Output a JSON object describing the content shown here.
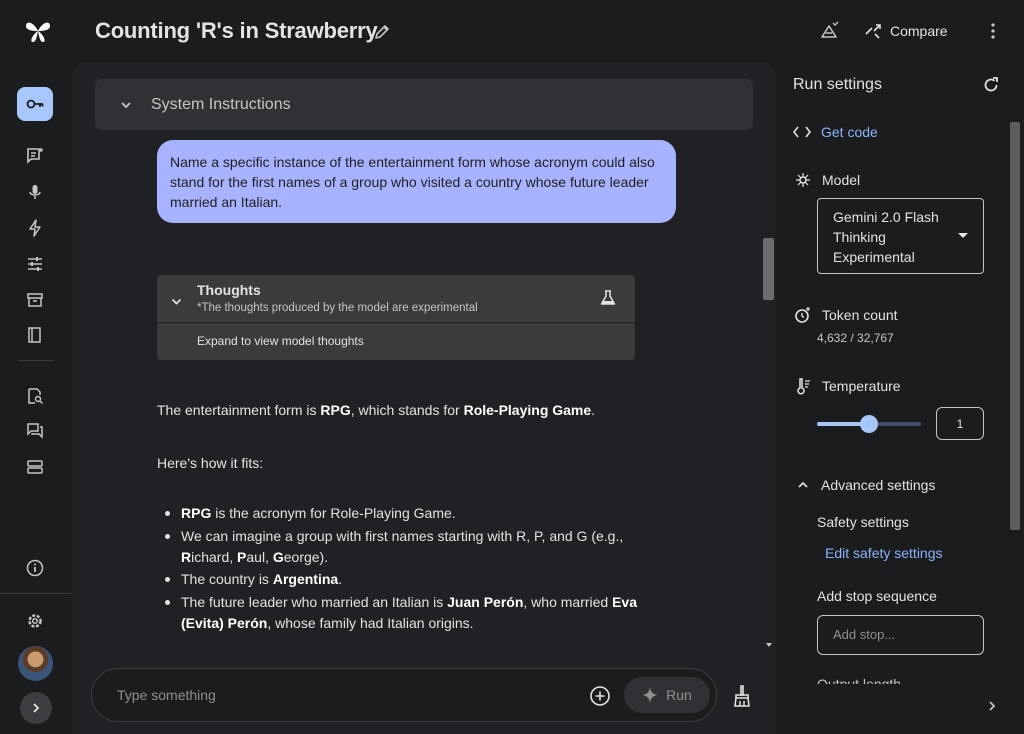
{
  "app": {
    "title": "Counting 'R's in Strawberry",
    "compare_label": "Compare"
  },
  "chat": {
    "system_instructions_label": "System Instructions",
    "user_message": "Name a specific instance of the entertainment form whose acronym could also stand for the first names of a group who visited a country whose future leader married an Italian.",
    "thoughts": {
      "title": "Thoughts",
      "subtitle": "*The thoughts produced by the model are experimental",
      "expand_label": "Expand to view model thoughts"
    },
    "response": {
      "p1": {
        "a": "The entertainment form is ",
        "b1": "RPG",
        "c": ", which stands for ",
        "b2": "Role-Playing Game",
        "d": "."
      },
      "p2": "Here's how it fits:",
      "bullets": {
        "b1": {
          "bold": "RPG",
          "text": " is the acronym for Role-Playing Game."
        },
        "b2": {
          "t1": "We can imagine a group with first names starting with R, P, and G (e.g., ",
          "r": "R",
          "r_rest": "ichard, ",
          "p": "P",
          "p_rest": "aul, ",
          "g": "G",
          "g_rest": "eorge)."
        },
        "b3": {
          "text": "The country is ",
          "bold": "Argentina",
          "end": "."
        },
        "b4": {
          "t1": "The future leader who married an Italian is ",
          "bold1": "Juan Perón",
          "t2": ", who married ",
          "bold2": "Eva (Evita) Perón",
          "t3": ", whose family had Italian origins."
        }
      }
    },
    "input_placeholder": "Type something",
    "run_label": "Run"
  },
  "settings": {
    "title": "Run settings",
    "get_code_label": "Get code",
    "model_label": "Model",
    "model_value": "Gemini 2.0 Flash Thinking Experimental",
    "token_count_label": "Token count",
    "token_count_value": "4,632 / 32,767",
    "temperature_label": "Temperature",
    "temperature_value": "1",
    "temperature_fraction": 0.5,
    "advanced_label": "Advanced settings",
    "safety_label": "Safety settings",
    "edit_safety_label": "Edit safety settings",
    "stop_sequence_label": "Add stop sequence",
    "stop_placeholder": "Add stop...",
    "output_length_label": "Output length"
  },
  "colors": {
    "accent": "#a8c7fa",
    "user_bubble": "#a8b3ff",
    "link": "#8ab4f8",
    "background": "#1b1c1e",
    "panel": "#202124"
  }
}
